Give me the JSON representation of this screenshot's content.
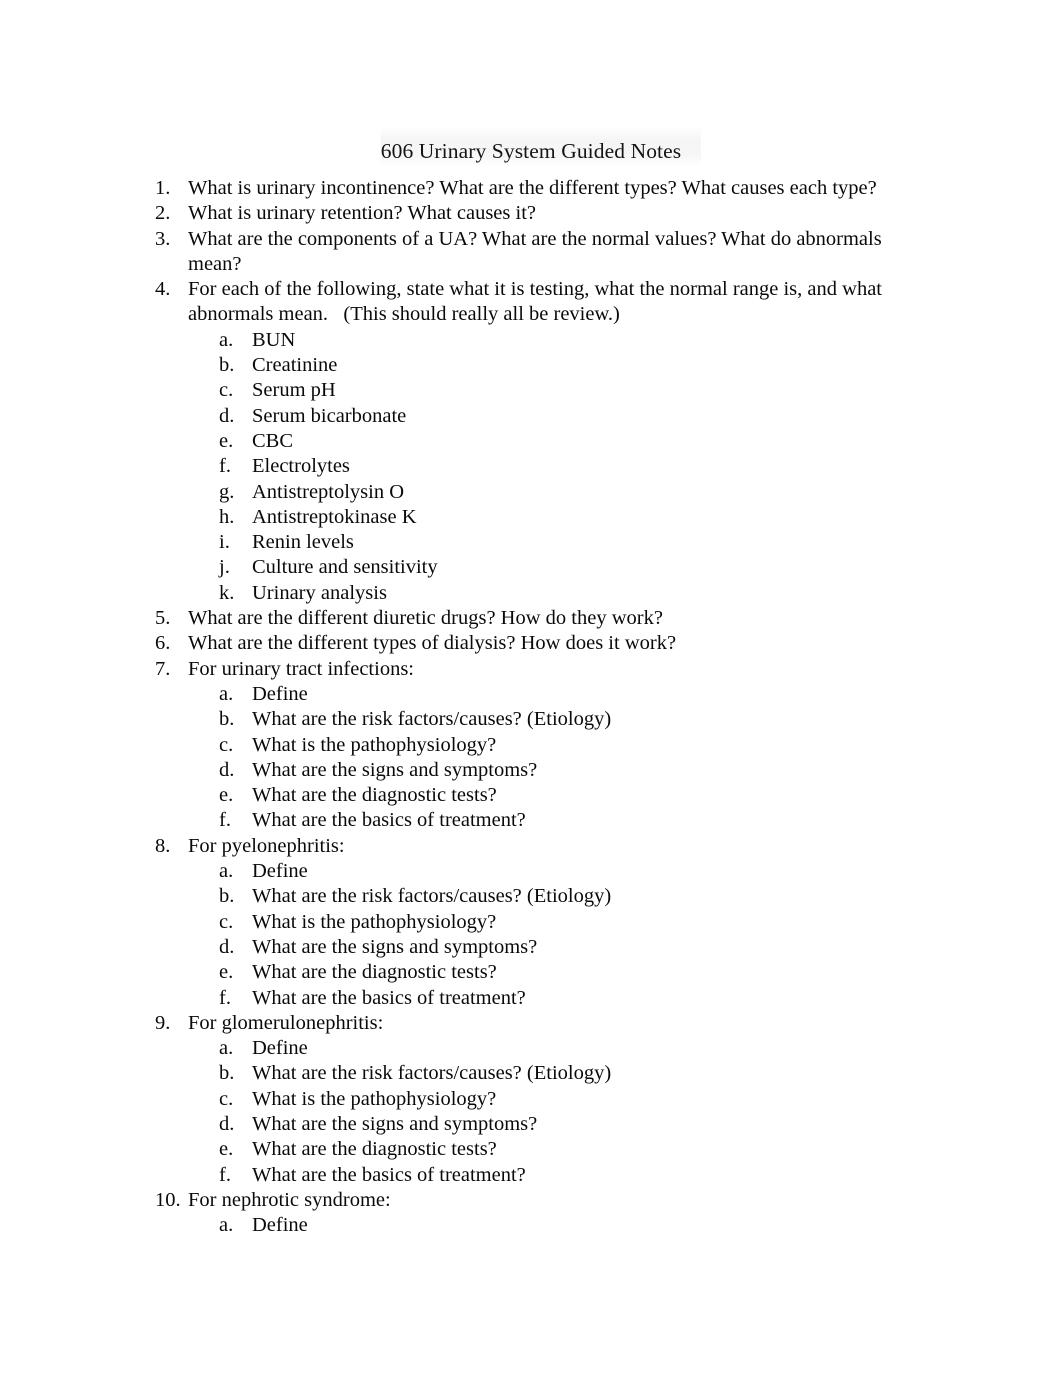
{
  "document": {
    "title": "606 Urinary System Guided Notes",
    "background_color": "#ffffff",
    "text_color": "#0a0a0a",
    "title_highlight_color": "#f4f4f4"
  },
  "items": [
    {
      "marker": "1.",
      "text": "What is urinary incontinence? What are the different types? What causes each type?",
      "subitems": []
    },
    {
      "marker": "2.",
      "text": "What is urinary retention? What causes it?",
      "subitems": []
    },
    {
      "marker": "3.",
      "text": "What are the components of a UA? What are the normal values? What do abnormals mean?",
      "subitems": []
    },
    {
      "marker": "4.",
      "text": "For each of the following, state what it is testing, what the normal range is, and what abnormals mean.   (This should really all be review.)",
      "subitems": [
        {
          "marker": "a.",
          "text": "BUN"
        },
        {
          "marker": "b.",
          "text": "Creatinine"
        },
        {
          "marker": "c.",
          "text": "Serum pH"
        },
        {
          "marker": "d.",
          "text": "Serum bicarbonate"
        },
        {
          "marker": "e.",
          "text": "CBC"
        },
        {
          "marker": "f.",
          "text": "Electrolytes"
        },
        {
          "marker": "g.",
          "text": "Antistreptolysin O"
        },
        {
          "marker": "h.",
          "text": "Antistreptokinase K"
        },
        {
          "marker": "i.",
          "text": "Renin levels"
        },
        {
          "marker": "j.",
          "text": "Culture and sensitivity"
        },
        {
          "marker": "k.",
          "text": "Urinary analysis"
        }
      ]
    },
    {
      "marker": "5.",
      "text": "What are the different diuretic drugs? How do they work?",
      "subitems": []
    },
    {
      "marker": "6.",
      "text": "What are the different types of dialysis? How does it work?",
      "subitems": []
    },
    {
      "marker": "7.",
      "text": "For urinary tract infections:",
      "subitems": [
        {
          "marker": "a.",
          "text": "Define"
        },
        {
          "marker": "b.",
          "text": "What are the risk factors/causes? (Etiology)"
        },
        {
          "marker": "c.",
          "text": "What is the pathophysiology?"
        },
        {
          "marker": "d.",
          "text": "What are the signs and symptoms?"
        },
        {
          "marker": "e.",
          "text": "What are the diagnostic tests?"
        },
        {
          "marker": "f.",
          "text": "What are the basics of treatment?"
        }
      ]
    },
    {
      "marker": "8.",
      "text": "For pyelonephritis:",
      "subitems": [
        {
          "marker": "a.",
          "text": "Define"
        },
        {
          "marker": "b.",
          "text": "What are the risk factors/causes? (Etiology)"
        },
        {
          "marker": "c.",
          "text": "What is the pathophysiology?"
        },
        {
          "marker": "d.",
          "text": "What are the signs and symptoms?"
        },
        {
          "marker": "e.",
          "text": "What are the diagnostic tests?"
        },
        {
          "marker": "f.",
          "text": "What are the basics of treatment?"
        }
      ]
    },
    {
      "marker": "9.",
      "text": "For glomerulonephritis:",
      "subitems": [
        {
          "marker": "a.",
          "text": "Define"
        },
        {
          "marker": "b.",
          "text": "What are the risk factors/causes? (Etiology)"
        },
        {
          "marker": "c.",
          "text": "What is the pathophysiology?"
        },
        {
          "marker": "d.",
          "text": "What are the signs and symptoms?"
        },
        {
          "marker": "e.",
          "text": "What are the diagnostic tests?"
        },
        {
          "marker": "f.",
          "text": "What are the basics of treatment?"
        }
      ]
    },
    {
      "marker": "10.",
      "text": "For nephrotic syndrome:",
      "subitems": [
        {
          "marker": "a.",
          "text": "Define"
        }
      ]
    }
  ]
}
